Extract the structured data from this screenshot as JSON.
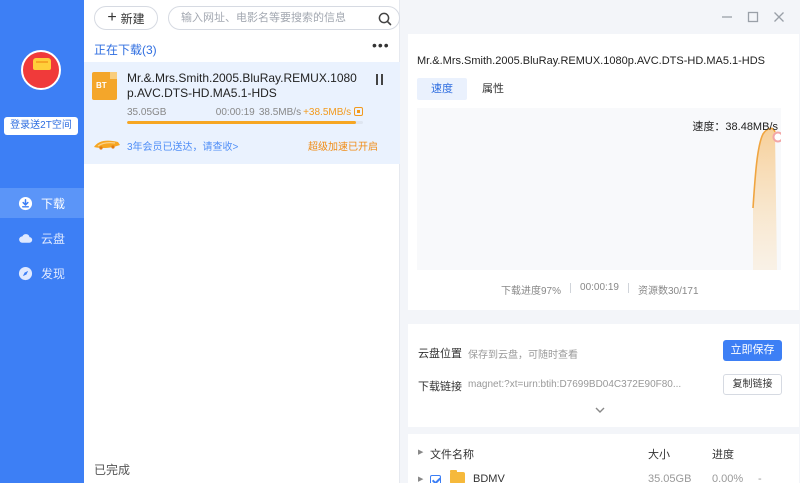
{
  "sidebar": {
    "promo_label": "登录送2T空间",
    "nav": [
      {
        "label": "下载",
        "icon": "download-icon",
        "active": true
      },
      {
        "label": "云盘",
        "icon": "cloud-icon",
        "active": false
      },
      {
        "label": "发现",
        "icon": "compass-icon",
        "active": false
      }
    ]
  },
  "toolbar": {
    "new_label": "新建",
    "search_placeholder": "输入网址、电影名等要搜索的信息"
  },
  "list": {
    "downloading_title": "正在下载(3)",
    "more_label": "•••",
    "completed_title": "已完成",
    "task": {
      "name": "Mr.&.Mrs.Smith.2005.BluRay.REMUX.1080p.AVC.DTS-HD.MA5.1-HDS",
      "icon_label": "BT",
      "size": "35.05GB",
      "eta": "00:00:19",
      "speed": "38.5MB/s",
      "boost": "+38.5MB/s",
      "progress": 0.97,
      "vip_message": "3年会员已送达，请查收>",
      "boost_status": "超级加速已开启"
    }
  },
  "detail": {
    "title": "Mr.&.Mrs.Smith.2005.BluRay.REMUX.1080p.AVC.DTS-HD.MA5.1-HDS",
    "tabs": {
      "speed": "速度",
      "props": "属性"
    },
    "speed_label": "速度：38.48MB/s",
    "stats": {
      "progress": "下载进度97%",
      "time": "00:00:19",
      "sources": "资源数30/171"
    },
    "cloud_label": "云盘位置",
    "cloud_value": "保存到云盘，可随时查看",
    "save_button": "立即保存",
    "link_label": "下载链接",
    "link_value": "magnet:?xt=urn:btih:D7699BD04C372E90F80...",
    "copy_button": "复制链接",
    "files": {
      "headers": {
        "name": "文件名称",
        "size": "大小",
        "progress": "进度"
      },
      "rows": [
        {
          "name": "BDMV",
          "size": "35.05GB",
          "progress": "0.00%",
          "extra": "-"
        }
      ]
    }
  },
  "colors": {
    "accent": "#3d7ff5",
    "boost": "#f6a623",
    "avatar": "#f03a3a"
  }
}
